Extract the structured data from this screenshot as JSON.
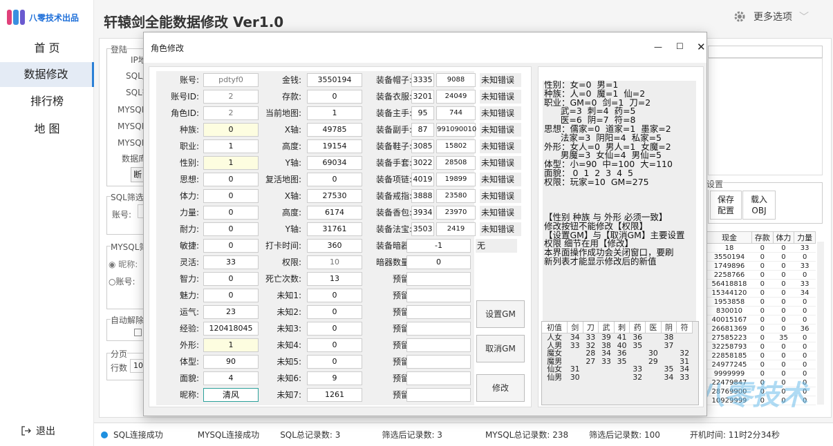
{
  "brand": {
    "text": "八零技术出品"
  },
  "nav": [
    {
      "label": "首 页"
    },
    {
      "label": "数据修改"
    },
    {
      "label": "排行榜"
    },
    {
      "label": "地 图"
    }
  ],
  "logout_label": "退出",
  "app_title": "轩辕剑全能数据修改  Ver1.0",
  "more_options": "更多选项",
  "bg": {
    "login_group": "登陆",
    "ip_label": "IP地",
    "sql_user": "SQL用",
    "sql_pwd": "SQL密",
    "mysql_user": "MYSQL用",
    "mysql_pwd": "MYSQL密",
    "mysql_db": "MYSQL端",
    "db_label": "数据库",
    "disconnect": "断",
    "sql_filter": "SQL筛选",
    "account_label": "账号:",
    "mysql_filter": "MYSQL筛",
    "radio_nick": "昵称:",
    "radio_account": "账号:",
    "auto_unlock": "自动解除",
    "page_group": "分页",
    "rows_label": "行数",
    "rows_value": "10",
    "settings_group": "设置",
    "save_config": "保存\n配置",
    "load_obj": "载入\nOBJ"
  },
  "right_table": {
    "headers": [
      "现金",
      "存款",
      "体力",
      "力量"
    ],
    "rows": [
      [
        "18",
        "0",
        "0",
        "33"
      ],
      [
        "3550194",
        "0",
        "0",
        "0"
      ],
      [
        "1749896",
        "0",
        "0",
        "33"
      ],
      [
        "2258766",
        "0",
        "0",
        "0"
      ],
      [
        "56418818",
        "0",
        "0",
        "33"
      ],
      [
        "15344120",
        "0",
        "0",
        "34"
      ],
      [
        "1953858",
        "0",
        "0",
        "0"
      ],
      [
        "830010",
        "0",
        "0",
        "0"
      ],
      [
        "40015167",
        "0",
        "0",
        "0"
      ],
      [
        "26681369",
        "0",
        "0",
        "36"
      ],
      [
        "27585223",
        "0",
        "35",
        "0"
      ],
      [
        "32258793",
        "0",
        "0",
        "0"
      ],
      [
        "22858185",
        "0",
        "0",
        "0"
      ],
      [
        "24977245",
        "0",
        "0",
        "0"
      ],
      [
        "9999999",
        "0",
        "0",
        "0"
      ],
      [
        "22479847",
        "0",
        "0",
        "0"
      ],
      [
        "28769900",
        "0",
        "0",
        "0"
      ],
      [
        "10929999",
        "0",
        "0",
        "0"
      ]
    ]
  },
  "watermark": "八零技术",
  "status": {
    "sql": "SQL连接成功",
    "mysql": "MYSQL连接成功",
    "sql_total": "SQL总记录数:  3",
    "filtered1": "筛选后记录数:  3",
    "mysql_total": "MYSQL总记录数:  238",
    "filtered2": "筛选后记录数:  100",
    "uptime": "开机时间:  11时2分34秒"
  },
  "dialog": {
    "title": "角色修改",
    "col1": [
      {
        "label": "账号:",
        "value": "pdtyf0",
        "style": "ro"
      },
      {
        "label": "账号ID:",
        "value": "2",
        "style": "ro"
      },
      {
        "label": "角色ID:",
        "value": "2",
        "style": "ro"
      },
      {
        "label": "种族:",
        "value": "0",
        "style": "y"
      },
      {
        "label": "职业:",
        "value": "1",
        "style": ""
      },
      {
        "label": "性别:",
        "value": "1",
        "style": "y"
      },
      {
        "label": "思想:",
        "value": "0",
        "style": ""
      },
      {
        "label": "体力:",
        "value": "0",
        "style": ""
      },
      {
        "label": "力量:",
        "value": "0",
        "style": ""
      },
      {
        "label": "耐力:",
        "value": "0",
        "style": ""
      },
      {
        "label": "敏捷:",
        "value": "0",
        "style": ""
      },
      {
        "label": "灵活:",
        "value": "33",
        "style": ""
      },
      {
        "label": "智力:",
        "value": "0",
        "style": ""
      },
      {
        "label": "魅力:",
        "value": "0",
        "style": ""
      },
      {
        "label": "运气:",
        "value": "23",
        "style": ""
      },
      {
        "label": "经验:",
        "value": "120418045",
        "style": ""
      },
      {
        "label": "外形:",
        "value": "1",
        "style": "y"
      },
      {
        "label": "体型:",
        "value": "90",
        "style": ""
      },
      {
        "label": "面貌:",
        "value": "4",
        "style": ""
      },
      {
        "label": "昵称:",
        "value": "清风",
        "style": "nick"
      }
    ],
    "col2": [
      {
        "label": "金钱:",
        "value": "3550194",
        "style": ""
      },
      {
        "label": "存款:",
        "value": "0",
        "style": ""
      },
      {
        "label": "当前地图:",
        "value": "1",
        "style": ""
      },
      {
        "label": "X轴:",
        "value": "49785",
        "style": ""
      },
      {
        "label": "高度:",
        "value": "19154",
        "style": ""
      },
      {
        "label": "Y轴:",
        "value": "69034",
        "style": ""
      },
      {
        "label": "复活地图:",
        "value": "0",
        "style": ""
      },
      {
        "label": "X轴:",
        "value": "27530",
        "style": ""
      },
      {
        "label": "高度:",
        "value": "6174",
        "style": ""
      },
      {
        "label": "Y轴:",
        "value": "31761",
        "style": ""
      },
      {
        "label": "打卡时间:",
        "value": "360",
        "style": ""
      },
      {
        "label": "权限:",
        "value": "10",
        "style": "ro"
      },
      {
        "label": "死亡次数:",
        "value": "13",
        "style": ""
      },
      {
        "label": "未知1:",
        "value": "0",
        "style": ""
      },
      {
        "label": "未知2:",
        "value": "0",
        "style": ""
      },
      {
        "label": "未知3:",
        "value": "0",
        "style": ""
      },
      {
        "label": "未知4:",
        "value": "0",
        "style": ""
      },
      {
        "label": "未知5:",
        "value": "0",
        "style": ""
      },
      {
        "label": "未知6:",
        "value": "9",
        "style": ""
      },
      {
        "label": "未知7:",
        "value": "1261",
        "style": ""
      }
    ],
    "col3": [
      {
        "label": "装备帽子:",
        "a": "3335",
        "b": "9088",
        "c": "未知错误"
      },
      {
        "label": "装备衣服:",
        "a": "3201",
        "b": "24049",
        "c": "未知错误"
      },
      {
        "label": "装备主手:",
        "a": "95",
        "b": "744",
        "c": "未知错误"
      },
      {
        "label": "装备副手:",
        "a": "87",
        "b": "991090010",
        "c": "未知错误"
      },
      {
        "label": "装备鞋子:",
        "a": "3085",
        "b": "15802",
        "c": "未知错误"
      },
      {
        "label": "装备手套:",
        "a": "3022",
        "b": "28508",
        "c": "未知错误"
      },
      {
        "label": "装备项链:",
        "a": "4019",
        "b": "19899",
        "c": "未知错误"
      },
      {
        "label": "装备戒指:",
        "a": "3888",
        "b": "23580",
        "c": "未知错误"
      },
      {
        "label": "装备香包:",
        "a": "3934",
        "b": "23970",
        "c": "未知错误"
      },
      {
        "label": "装备法宝:",
        "a": "3503",
        "b": "2419",
        "c": "未知错误"
      }
    ],
    "hidden_weapon": {
      "label": "装备暗器:",
      "value": "-1",
      "status": "无"
    },
    "hidden_count": {
      "label": "暗器数量:",
      "value": "0"
    },
    "reserved_label": "预留:",
    "set_gm": "设置GM",
    "cancel_gm": "取消GM",
    "modify": "修改",
    "info_text": "性别：女=0  男=1\n种族：人=0  魔=1  仙=2\n职业：GM=0  剑=1  刀=2\n      武=3  刺=4  药=5\n      医=6  阴=7  符=8\n思想：儒家=0  道家=1  墨家=2\n      法家=3  阴阳=4  私家=5\n外形：女人=0  男人=1  女魔=2\n      男魔=3  女仙=4  男仙=5\n体型：小=90  中=100  大=110\n面貌： 0  1  2  3  4  5\n权限：玩家=10  GM=275\n\n\n\n【性别 种族 与 外形 必须一致】\n修改按钮不能修改【权限】\n【设置GM】与【取消GM】主要设置\n权限 细节在用【修改】\n本界面操作成功会关闭窗口，要刷\n新列表才能显示修改后的新值",
    "class_table": {
      "headers": [
        "初值",
        "剑",
        "刀",
        "武",
        "刺",
        "药",
        "医",
        "阴",
        "符"
      ],
      "rows": [
        [
          "人女",
          "34",
          "33",
          "39",
          "41",
          "36",
          "",
          "38",
          ""
        ],
        [
          "人男",
          "33",
          "32",
          "38",
          "40",
          "35",
          "",
          "37",
          ""
        ],
        [
          "魔女",
          "",
          "28",
          "34",
          "36",
          "",
          "30",
          "",
          "32"
        ],
        [
          "魔男",
          "",
          "27",
          "33",
          "35",
          "",
          "29",
          "",
          "31"
        ],
        [
          "仙女",
          "31",
          "",
          "",
          "",
          "33",
          "",
          "35",
          "34"
        ],
        [
          "仙男",
          "30",
          "",
          "",
          "",
          "32",
          "",
          "34",
          "33"
        ]
      ]
    }
  }
}
